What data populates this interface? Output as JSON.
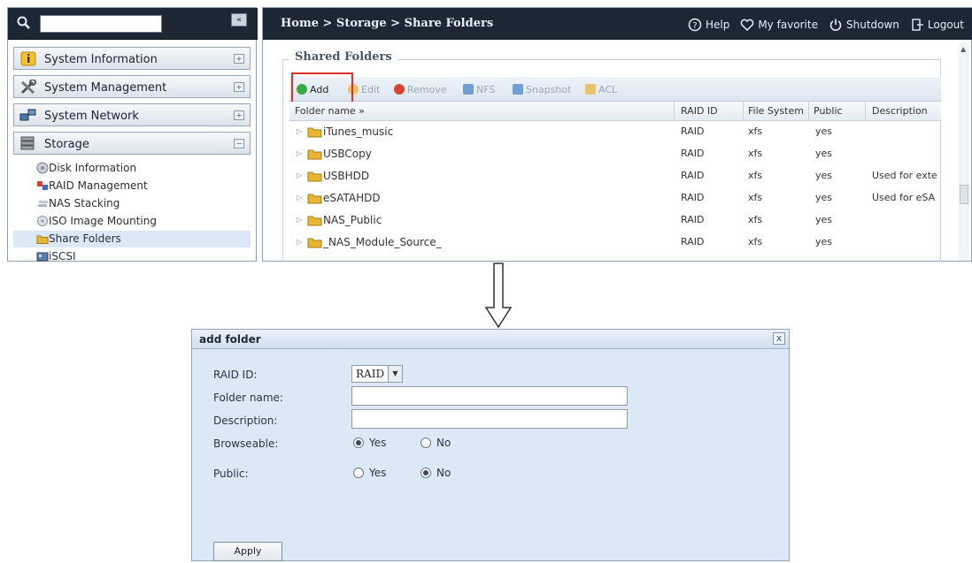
{
  "sidebar": {
    "sections": [
      {
        "label": "System Information",
        "icon": "info-icon"
      },
      {
        "label": "System Management",
        "icon": "tools-icon"
      },
      {
        "label": "System Network",
        "icon": "network-icon"
      },
      {
        "label": "Storage",
        "icon": "storage-icon"
      }
    ],
    "storage_items": [
      {
        "label": "Disk Information",
        "icon": "disk-icon"
      },
      {
        "label": "RAID Management",
        "icon": "raid-icon"
      },
      {
        "label": "NAS Stacking",
        "icon": "stacking-icon"
      },
      {
        "label": "ISO Image Mounting",
        "icon": "iso-icon"
      },
      {
        "label": "Share Folders",
        "icon": "folder-icon",
        "active": true
      },
      {
        "label": "iSCSI",
        "icon": "iscsi-icon"
      }
    ]
  },
  "header": {
    "breadcrumb": "Home > Storage > Share Folders",
    "actions": {
      "help": "Help",
      "favorite": "My favorite",
      "shutdown": "Shutdown",
      "logout": "Logout"
    }
  },
  "panel": {
    "title": "Shared Folders",
    "toolbar": {
      "add": "Add",
      "edit": "Edit",
      "remove": "Remove",
      "nfs": "NFS",
      "snapshot": "Snapshot",
      "acl": "ACL"
    },
    "columns": {
      "folder_name": "Folder name »",
      "raid_id": "RAID ID",
      "file_system": "File System",
      "public": "Public",
      "description": "Description"
    },
    "rows": [
      {
        "name": "iTunes_music",
        "raid": "RAID",
        "fs": "xfs",
        "public": "yes",
        "desc": ""
      },
      {
        "name": "USBCopy",
        "raid": "RAID",
        "fs": "xfs",
        "public": "yes",
        "desc": ""
      },
      {
        "name": "USBHDD",
        "raid": "RAID",
        "fs": "xfs",
        "public": "yes",
        "desc": "Used for exte"
      },
      {
        "name": "eSATAHDD",
        "raid": "RAID",
        "fs": "xfs",
        "public": "yes",
        "desc": "Used for eSA"
      },
      {
        "name": "NAS_Public",
        "raid": "RAID",
        "fs": "xfs",
        "public": "yes",
        "desc": ""
      },
      {
        "name": "_NAS_Module_Source_",
        "raid": "RAID",
        "fs": "xfs",
        "public": "yes",
        "desc": ""
      }
    ]
  },
  "dialog": {
    "title": "add folder",
    "close": "x",
    "labels": {
      "raid_id": "RAID ID:",
      "folder_name": "Folder name:",
      "description": "Description:",
      "browseable": "Browseable:",
      "public": "Public:"
    },
    "raid_value": "RAID",
    "folder_name_value": "",
    "description_value": "",
    "yes": "Yes",
    "no": "No",
    "browseable_selected": "Yes",
    "public_selected": "No",
    "apply": "Apply"
  },
  "colors": {
    "header_bg": "#1c2733",
    "highlight": "#d9302a",
    "dialog_bg": "#dce8f6",
    "folder": "#e8b534",
    "add_green": "#3aa845",
    "remove_red": "#d9442f"
  }
}
